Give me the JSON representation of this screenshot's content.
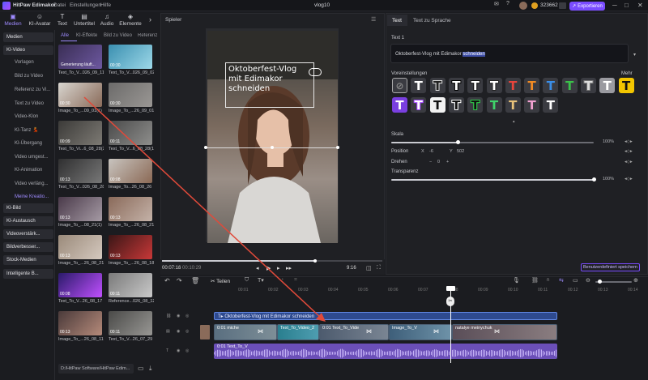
{
  "app": {
    "title": "HitPaw Edimakor",
    "menu": [
      "Datei",
      "Einstellungen",
      "Hilfe"
    ],
    "project": "vlog10",
    "credits": "323662",
    "export_label": "Exportieren"
  },
  "top_tabs": [
    {
      "label": "Medien",
      "icon": "folder-icon"
    },
    {
      "label": "KI-Avatar",
      "icon": "avatar-icon"
    },
    {
      "label": "Text",
      "icon": "text-icon"
    },
    {
      "label": "Untertitel",
      "icon": "subtitle-icon"
    },
    {
      "label": "Audio",
      "icon": "audio-icon"
    },
    {
      "label": "Elemente",
      "icon": "elements-icon"
    }
  ],
  "left_nav": [
    {
      "label": "Medien",
      "type": "hd"
    },
    {
      "label": "KI-Video",
      "type": "hd"
    },
    {
      "label": "Vorlagen",
      "type": "sub"
    },
    {
      "label": "Bild zu Video",
      "type": "sub"
    },
    {
      "label": "Referenz zu Vi...",
      "type": "sub"
    },
    {
      "label": "Text zu Video",
      "type": "sub"
    },
    {
      "label": "Video-Klon",
      "type": "sub"
    },
    {
      "label": "KI-Tanz 💃",
      "type": "sub"
    },
    {
      "label": "KI-Übergang",
      "type": "sub"
    },
    {
      "label": "Video umgest...",
      "type": "sub"
    },
    {
      "label": "KI-Animation",
      "type": "sub"
    },
    {
      "label": "Video verläng...",
      "type": "sub"
    },
    {
      "label": "Meine Kreatio...",
      "type": "purple"
    },
    {
      "label": "KI-Bild",
      "type": "hd"
    },
    {
      "label": "KI-Austausch",
      "type": "hd"
    },
    {
      "label": "Videoverstärk...",
      "type": "hd"
    },
    {
      "label": "Bildverbesser...",
      "type": "hd"
    },
    {
      "label": "Stock-Medien",
      "type": "hd"
    },
    {
      "label": "Intelligente B...",
      "type": "hd"
    }
  ],
  "media_tabs": [
    "Alle",
    "KI-Effekte",
    "Bild zu Video",
    "Referenz"
  ],
  "media_items": [
    {
      "caption": "Text_To_V...026_09_11",
      "duration": "",
      "badge": "Generierung läuft..."
    },
    {
      "caption": "Text_To_V...026_09_02",
      "duration": "00:30"
    },
    {
      "caption": "Image_To_...09_01(1)",
      "duration": "00:30"
    },
    {
      "caption": "Image_To_...26_09_01",
      "duration": "00:30"
    },
    {
      "caption": "Text_To_Vi...6_08_28(2)",
      "duration": "00:09"
    },
    {
      "caption": "Text_To_V...6_08_28(1)",
      "duration": "00:11"
    },
    {
      "caption": "Text_To_V...026_08_28",
      "duration": "00:13"
    },
    {
      "caption": "Image_To...26_08_26",
      "duration": "00:08"
    },
    {
      "caption": "Image_To_...08_21(1)",
      "duration": "00:13"
    },
    {
      "caption": "Image_To_...26_08_21",
      "duration": "00:13"
    },
    {
      "caption": "Image_To_...26_08_21",
      "duration": "00:13"
    },
    {
      "caption": "Image_To_...26_08_18",
      "duration": "00:13"
    },
    {
      "caption": "Text_To_V...26_08_17",
      "duration": "00:08"
    },
    {
      "caption": "Reference...026_08_12",
      "duration": "00:11"
    },
    {
      "caption": "Image_To_...26_08_11",
      "duration": "00:13"
    },
    {
      "caption": "Text_To_V...26_07_29",
      "duration": "00:11"
    }
  ],
  "path": "D:/HitPaw Software/HitPaw Edim...",
  "player": {
    "label": "Spieler",
    "overlay_lines": [
      "Oktoberfest-Vlog",
      "mit Edimakor",
      "schneiden"
    ],
    "current_time": "00:07:16",
    "total_time": "00:10:29",
    "aspect": "9:16"
  },
  "text_panel": {
    "tabs": [
      "Text",
      "Text zu Sprache"
    ],
    "field_label": "Text 1",
    "text_value": "Oktoberfest-Vlog mit Edimakor",
    "text_highlight": "schneiden",
    "presets_label": "Voreinstellungen",
    "more_label": "Mehr",
    "scale_label": "Skala",
    "scale_value": "100%",
    "position_label": "Position",
    "pos_x_label": "X",
    "pos_x": "-6",
    "pos_y_label": "Y",
    "pos_y": "502",
    "rotate_label": "Drehen",
    "rotate_value": "0",
    "opacity_label": "Transparenz",
    "opacity_value": "100%",
    "custom_save_label": "Benutzerdefiniert speichern"
  },
  "toolbar": {
    "split_label": "Teilen"
  },
  "timeline": {
    "text_clip": "Oktoberfest-Vlog mit Edimakor schneiden",
    "video_clips": [
      "0:01 miche",
      "Text_To_Video_2",
      "0:01 Text_To_Vide",
      "Image_To_V",
      "natalye meinychuk"
    ],
    "audio_clip": "0:01 Text_To_V",
    "ruler_ticks": [
      "00:01",
      "00:02",
      "00:03",
      "00:04",
      "00:05",
      "00:06",
      "00:07",
      "00:08",
      "00:09",
      "00:10",
      "00:11",
      "00:12",
      "00:13",
      "00:14"
    ]
  },
  "colors": {
    "accent": "#7a4cff",
    "text_clip": "#2e4a8f",
    "audio": "#6b4fb8"
  }
}
